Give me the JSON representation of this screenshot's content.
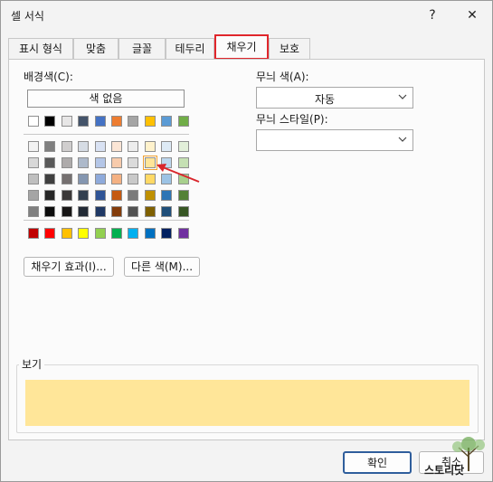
{
  "dialog": {
    "title": "셀 서식",
    "help_label": "?",
    "close_label": "✕"
  },
  "tabs": [
    {
      "label": "표시 형식"
    },
    {
      "label": "맞춤"
    },
    {
      "label": "글꼴"
    },
    {
      "label": "테두리"
    },
    {
      "label": "채우기",
      "active": true
    },
    {
      "label": "보호"
    }
  ],
  "fill": {
    "background_label": "배경색(C):",
    "no_color_label": "색 없음",
    "theme_top_row": [
      "#ffffff",
      "#000000",
      "#e7e6e6",
      "#44546a",
      "#4472c4",
      "#ed7d31",
      "#a5a5a5",
      "#ffc000",
      "#5b9bd5",
      "#70ad47"
    ],
    "tint_rows": [
      [
        "#f2f2f2",
        "#7f7f7f",
        "#d0cece",
        "#d6dce4",
        "#d9e2f3",
        "#fbe5d5",
        "#ededed",
        "#fff2cc",
        "#deebf6",
        "#e2efd9"
      ],
      [
        "#d8d8d8",
        "#595959",
        "#aeabab",
        "#adb9ca",
        "#b4c6e7",
        "#f7cbac",
        "#dbdbdb",
        "#ffe598",
        "#bdd7ee",
        "#c5e0b3"
      ],
      [
        "#bfbfbf",
        "#3f3f3f",
        "#757070",
        "#8496b0",
        "#8eaadb",
        "#f4b183",
        "#c9c9c9",
        "#ffd965",
        "#9cc3e5",
        "#a8d08d"
      ],
      [
        "#a5a5a5",
        "#262626",
        "#3a3838",
        "#323f4f",
        "#2f5496",
        "#c55a11",
        "#7b7b7b",
        "#bf9000",
        "#2e75b5",
        "#538135"
      ],
      [
        "#7f7f7f",
        "#0c0c0c",
        "#171616",
        "#222a35",
        "#1f3864",
        "#833c0b",
        "#525252",
        "#7f6000",
        "#1f4e79",
        "#375623"
      ]
    ],
    "standard_row": [
      "#c00000",
      "#ff0000",
      "#ffc000",
      "#ffff00",
      "#92d050",
      "#00b050",
      "#00b0f0",
      "#0070c0",
      "#002060",
      "#7030a0"
    ],
    "fill_effects_label": "채우기 효과(I)...",
    "more_colors_label": "다른 색(M)...",
    "pattern_color_label": "무늬 색(A):",
    "pattern_color_value": "자동",
    "pattern_style_label": "무늬 스타일(P):",
    "pattern_style_value": "",
    "sample_label": "보기",
    "sample_color": "#ffe699",
    "arrow_color": "#d9262c"
  },
  "footer": {
    "ok_label": "확인",
    "cancel_label": "취소"
  },
  "watermark": "스토리닷"
}
